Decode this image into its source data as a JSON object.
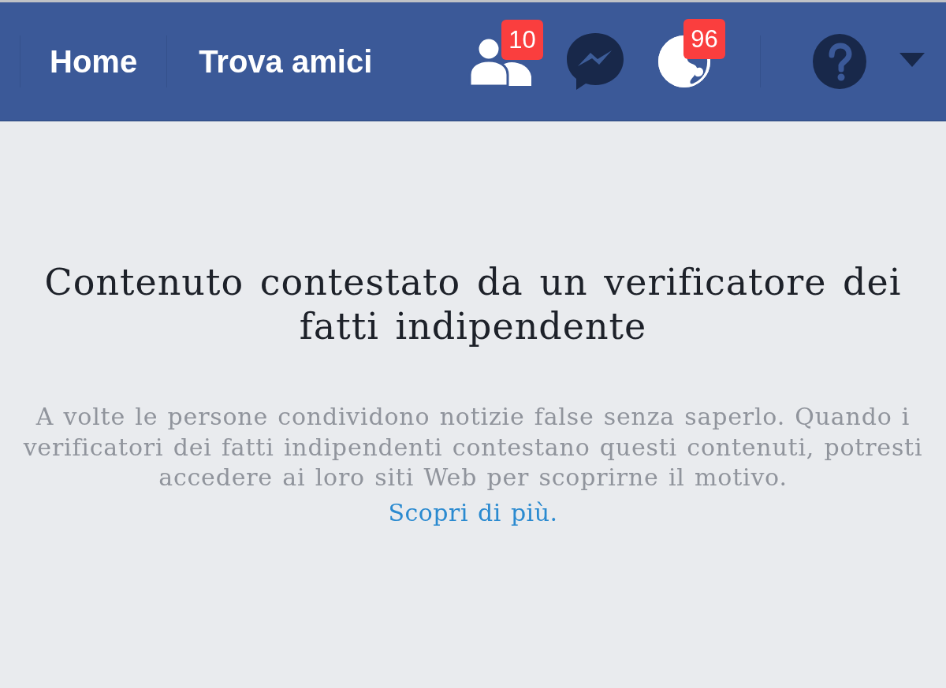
{
  "navbar": {
    "links": [
      {
        "label": "Home"
      },
      {
        "label": "Trova amici"
      }
    ],
    "icons": [
      {
        "kind": "friends",
        "badge": "10"
      },
      {
        "kind": "messages"
      },
      {
        "kind": "notifications",
        "badge": "96"
      }
    ],
    "right_icons": [
      {
        "kind": "help"
      },
      {
        "kind": "menu_caret"
      }
    ]
  },
  "notice": {
    "title": "Contenuto contestato da un verificatore dei fatti indipendente",
    "body": "A volte le persone condividono notizie false senza saperlo. Quando i verificatori dei fatti indipendenti contestano questi contenuti, potresti accedere ai loro siti Web per scoprirne il motivo.",
    "link": "Scopri di più."
  }
}
